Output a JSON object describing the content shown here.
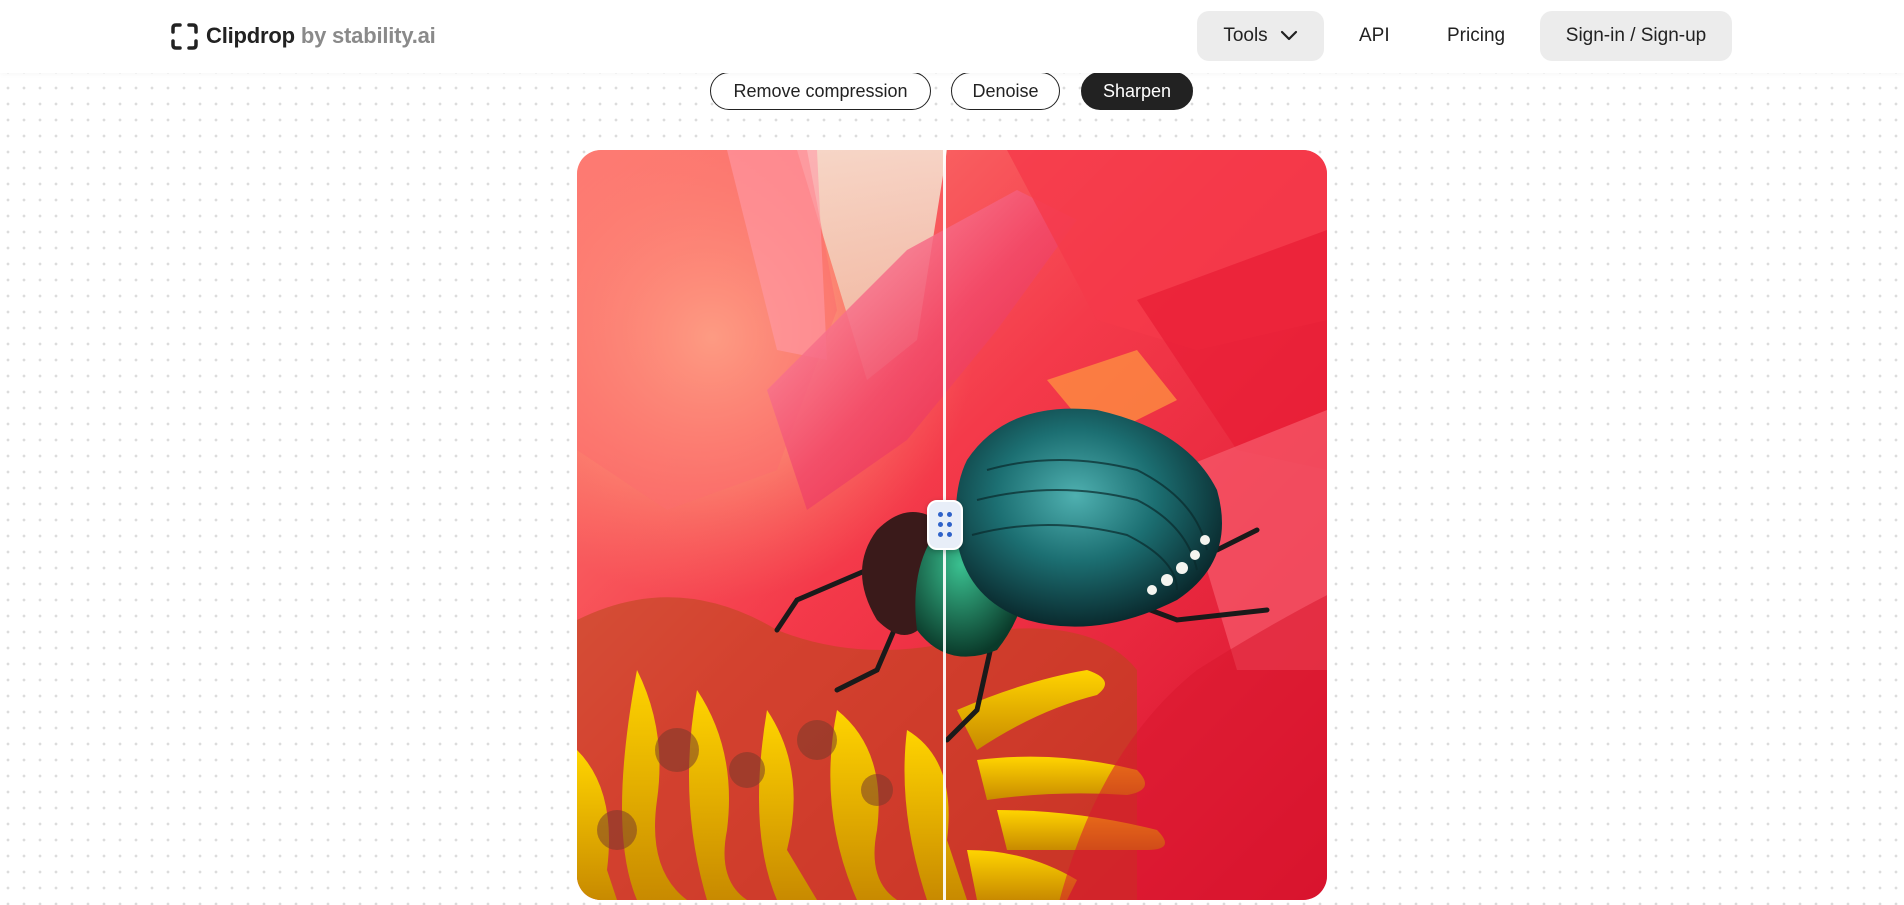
{
  "header": {
    "logo": {
      "name": "Clipdrop",
      "by": "by stability.ai",
      "icon": "clipdrop-logo-icon"
    },
    "nav": {
      "tools_label": "Tools",
      "tools_icon": "chevron-down-icon",
      "api_label": "API",
      "pricing_label": "Pricing",
      "signin_label": "Sign-in / Sign-up"
    }
  },
  "modes": [
    {
      "label": "Remove compression",
      "active": false
    },
    {
      "label": "Denoise",
      "active": false
    },
    {
      "label": "Sharpen",
      "active": true
    }
  ],
  "comparison": {
    "handle_icon": "drag-handle-icon",
    "split_fraction": 0.49
  },
  "colors": {
    "accent_dark": "#222222",
    "handle_dots": "#2f62c9"
  }
}
